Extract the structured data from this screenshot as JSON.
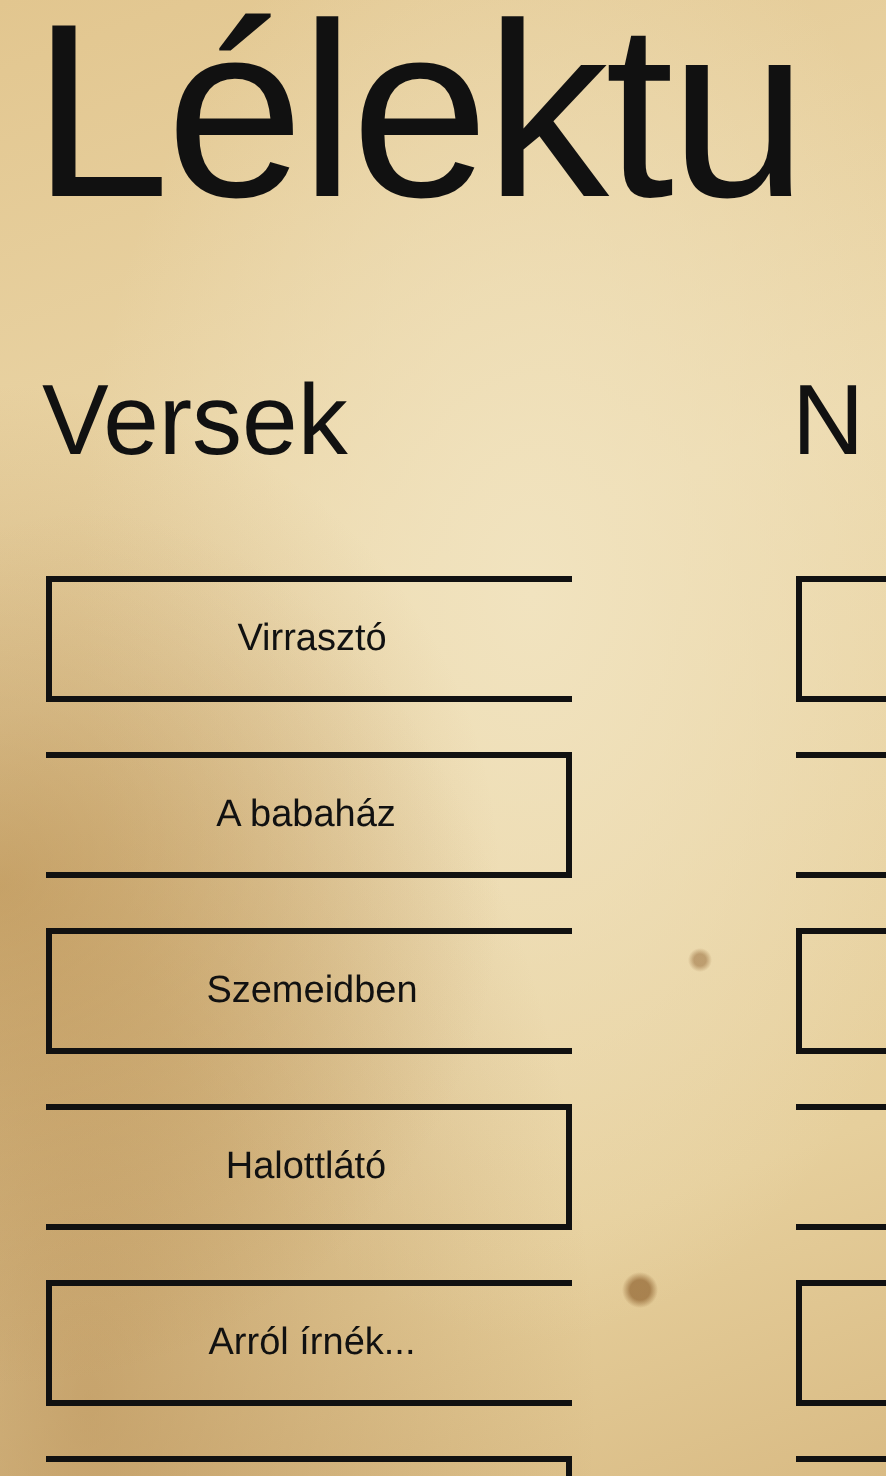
{
  "title": "Lélektu",
  "panels": [
    {
      "heading": "Versek",
      "buttons": [
        {
          "label": "Virrasztó",
          "kind": "open-right"
        },
        {
          "label": "A babaház",
          "kind": "open-left"
        },
        {
          "label": "Szemeidben",
          "kind": "open-right"
        },
        {
          "label": "Halottlátó",
          "kind": "open-left"
        },
        {
          "label": "Arról írnék...",
          "kind": "open-right"
        },
        {
          "kind": "open-left"
        }
      ]
    },
    {
      "heading": "N",
      "buttons": [
        {
          "kind": "open-right"
        },
        {
          "kind": "open-left"
        },
        {
          "kind": "open-right"
        },
        {
          "kind": "open-left"
        },
        {
          "kind": "open-right"
        },
        {
          "kind": "open-left"
        }
      ]
    }
  ]
}
